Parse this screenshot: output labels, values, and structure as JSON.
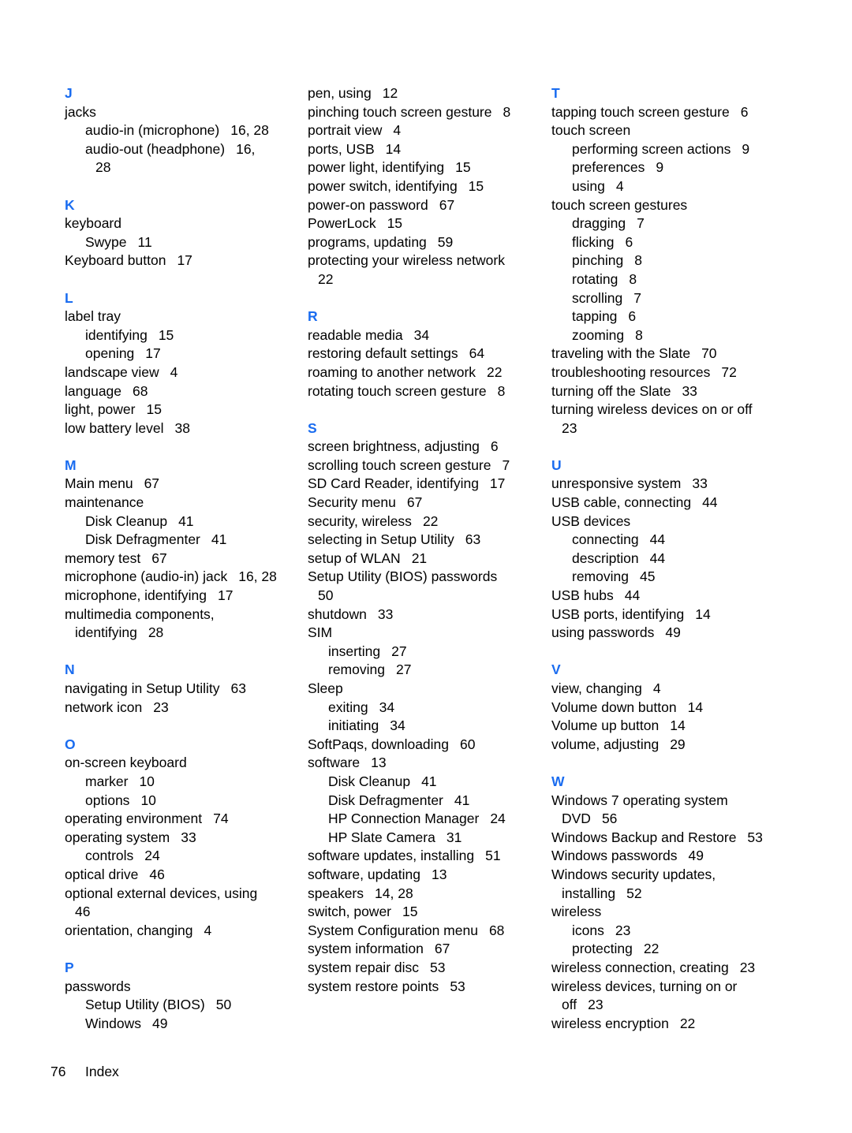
{
  "accent_color": "#1a6cf0",
  "columns": [
    [
      {
        "t": "h",
        "text": "J"
      },
      {
        "t": "e",
        "lvl": 1,
        "text": "jacks",
        "pages": ""
      },
      {
        "t": "e",
        "lvl": 2,
        "text": "audio-in (microphone)",
        "pages": "16, 28"
      },
      {
        "t": "e",
        "lvl": 2,
        "text": "audio-out (headphone)",
        "pages": "16,"
      },
      {
        "t": "c",
        "lvl": 2,
        "text": "",
        "pages": "28"
      },
      {
        "t": "g"
      },
      {
        "t": "h",
        "text": "K"
      },
      {
        "t": "e",
        "lvl": 1,
        "text": "keyboard",
        "pages": ""
      },
      {
        "t": "e",
        "lvl": 2,
        "text": "Swype",
        "pages": "11"
      },
      {
        "t": "e",
        "lvl": 1,
        "text": "Keyboard button",
        "pages": "17"
      },
      {
        "t": "g"
      },
      {
        "t": "h",
        "text": "L"
      },
      {
        "t": "e",
        "lvl": 1,
        "text": "label tray",
        "pages": ""
      },
      {
        "t": "e",
        "lvl": 2,
        "text": "identifying",
        "pages": "15"
      },
      {
        "t": "e",
        "lvl": 2,
        "text": "opening",
        "pages": "17"
      },
      {
        "t": "e",
        "lvl": 1,
        "text": "landscape view",
        "pages": "4"
      },
      {
        "t": "e",
        "lvl": 1,
        "text": "language",
        "pages": "68"
      },
      {
        "t": "e",
        "lvl": 1,
        "text": "light, power",
        "pages": "15"
      },
      {
        "t": "e",
        "lvl": 1,
        "text": "low battery level",
        "pages": "38"
      },
      {
        "t": "g"
      },
      {
        "t": "h",
        "text": "M"
      },
      {
        "t": "e",
        "lvl": 1,
        "text": "Main menu",
        "pages": "67"
      },
      {
        "t": "e",
        "lvl": 1,
        "text": "maintenance",
        "pages": ""
      },
      {
        "t": "e",
        "lvl": 2,
        "text": "Disk Cleanup",
        "pages": "41"
      },
      {
        "t": "e",
        "lvl": 2,
        "text": "Disk Defragmenter",
        "pages": "41"
      },
      {
        "t": "e",
        "lvl": 1,
        "text": "memory test",
        "pages": "67"
      },
      {
        "t": "e",
        "lvl": 1,
        "text": "microphone (audio-in) jack",
        "pages": "16, 28"
      },
      {
        "t": "e",
        "lvl": 1,
        "text": "microphone, identifying",
        "pages": "17"
      },
      {
        "t": "e",
        "lvl": 1,
        "text": "multimedia components,",
        "pages": ""
      },
      {
        "t": "c",
        "lvl": 1,
        "text": "identifying",
        "pages": "28"
      },
      {
        "t": "g"
      },
      {
        "t": "h",
        "text": "N"
      },
      {
        "t": "e",
        "lvl": 1,
        "text": "navigating in Setup Utility",
        "pages": "63"
      },
      {
        "t": "e",
        "lvl": 1,
        "text": "network icon",
        "pages": "23"
      },
      {
        "t": "g"
      },
      {
        "t": "h",
        "text": "O"
      },
      {
        "t": "e",
        "lvl": 1,
        "text": "on-screen keyboard",
        "pages": ""
      },
      {
        "t": "e",
        "lvl": 2,
        "text": "marker",
        "pages": "10"
      },
      {
        "t": "e",
        "lvl": 2,
        "text": "options",
        "pages": "10"
      },
      {
        "t": "e",
        "lvl": 1,
        "text": "operating environment",
        "pages": "74"
      },
      {
        "t": "e",
        "lvl": 1,
        "text": "operating system",
        "pages": "33"
      },
      {
        "t": "e",
        "lvl": 2,
        "text": "controls",
        "pages": "24"
      },
      {
        "t": "e",
        "lvl": 1,
        "text": "optical drive",
        "pages": "46"
      },
      {
        "t": "e",
        "lvl": 1,
        "text": "optional external devices, using",
        "pages": ""
      },
      {
        "t": "c",
        "lvl": 1,
        "text": "",
        "pages": "46"
      },
      {
        "t": "e",
        "lvl": 1,
        "text": "orientation, changing",
        "pages": "4"
      },
      {
        "t": "g"
      },
      {
        "t": "h",
        "text": "P"
      },
      {
        "t": "e",
        "lvl": 1,
        "text": "passwords",
        "pages": ""
      },
      {
        "t": "e",
        "lvl": 2,
        "text": "Setup Utility (BIOS)",
        "pages": "50"
      },
      {
        "t": "e",
        "lvl": 2,
        "text": "Windows",
        "pages": "49"
      }
    ],
    [
      {
        "t": "e",
        "lvl": 1,
        "text": "pen, using",
        "pages": "12"
      },
      {
        "t": "e",
        "lvl": 1,
        "text": "pinching touch screen gesture",
        "pages": "8"
      },
      {
        "t": "e",
        "lvl": 1,
        "text": "portrait view",
        "pages": "4"
      },
      {
        "t": "e",
        "lvl": 1,
        "text": "ports, USB",
        "pages": "14"
      },
      {
        "t": "e",
        "lvl": 1,
        "text": "power light, identifying",
        "pages": "15"
      },
      {
        "t": "e",
        "lvl": 1,
        "text": "power switch, identifying",
        "pages": "15"
      },
      {
        "t": "e",
        "lvl": 1,
        "text": "power-on password",
        "pages": "67"
      },
      {
        "t": "e",
        "lvl": 1,
        "text": "PowerLock",
        "pages": "15"
      },
      {
        "t": "e",
        "lvl": 1,
        "text": "programs, updating",
        "pages": "59"
      },
      {
        "t": "e",
        "lvl": 1,
        "text": "protecting your wireless network",
        "pages": ""
      },
      {
        "t": "c",
        "lvl": 1,
        "text": "",
        "pages": "22"
      },
      {
        "t": "g"
      },
      {
        "t": "h",
        "text": "R"
      },
      {
        "t": "e",
        "lvl": 1,
        "text": "readable media",
        "pages": "34"
      },
      {
        "t": "e",
        "lvl": 1,
        "text": "restoring default settings",
        "pages": "64"
      },
      {
        "t": "e",
        "lvl": 1,
        "text": "roaming to another network",
        "pages": "22"
      },
      {
        "t": "e",
        "lvl": 1,
        "text": "rotating touch screen gesture",
        "pages": "8"
      },
      {
        "t": "g"
      },
      {
        "t": "h",
        "text": "S"
      },
      {
        "t": "e",
        "lvl": 1,
        "text": "screen brightness, adjusting",
        "pages": "6"
      },
      {
        "t": "e",
        "lvl": 1,
        "text": "scrolling touch screen gesture",
        "pages": "7"
      },
      {
        "t": "e",
        "lvl": 1,
        "text": "SD Card Reader, identifying",
        "pages": "17"
      },
      {
        "t": "e",
        "lvl": 1,
        "text": "Security menu",
        "pages": "67"
      },
      {
        "t": "e",
        "lvl": 1,
        "text": "security, wireless",
        "pages": "22"
      },
      {
        "t": "e",
        "lvl": 1,
        "text": "selecting in Setup Utility",
        "pages": "63"
      },
      {
        "t": "e",
        "lvl": 1,
        "text": "setup of WLAN",
        "pages": "21"
      },
      {
        "t": "e",
        "lvl": 1,
        "text": "Setup Utility (BIOS) passwords",
        "pages": ""
      },
      {
        "t": "c",
        "lvl": 1,
        "text": "",
        "pages": "50"
      },
      {
        "t": "e",
        "lvl": 1,
        "text": "shutdown",
        "pages": "33"
      },
      {
        "t": "e",
        "lvl": 1,
        "text": "SIM",
        "pages": ""
      },
      {
        "t": "e",
        "lvl": 2,
        "text": "inserting",
        "pages": "27"
      },
      {
        "t": "e",
        "lvl": 2,
        "text": "removing",
        "pages": "27"
      },
      {
        "t": "e",
        "lvl": 1,
        "text": "Sleep",
        "pages": ""
      },
      {
        "t": "e",
        "lvl": 2,
        "text": "exiting",
        "pages": "34"
      },
      {
        "t": "e",
        "lvl": 2,
        "text": "initiating",
        "pages": "34"
      },
      {
        "t": "e",
        "lvl": 1,
        "text": "SoftPaqs, downloading",
        "pages": "60"
      },
      {
        "t": "e",
        "lvl": 1,
        "text": "software",
        "pages": "13"
      },
      {
        "t": "e",
        "lvl": 2,
        "text": "Disk Cleanup",
        "pages": "41"
      },
      {
        "t": "e",
        "lvl": 2,
        "text": "Disk Defragmenter",
        "pages": "41"
      },
      {
        "t": "e",
        "lvl": 2,
        "text": "HP Connection Manager",
        "pages": "24"
      },
      {
        "t": "e",
        "lvl": 2,
        "text": "HP Slate Camera",
        "pages": "31"
      },
      {
        "t": "e",
        "lvl": 1,
        "text": "software updates, installing",
        "pages": "51"
      },
      {
        "t": "e",
        "lvl": 1,
        "text": "software, updating",
        "pages": "13"
      },
      {
        "t": "e",
        "lvl": 1,
        "text": "speakers",
        "pages": "14, 28"
      },
      {
        "t": "e",
        "lvl": 1,
        "text": "switch, power",
        "pages": "15"
      },
      {
        "t": "e",
        "lvl": 1,
        "text": "System Configuration menu",
        "pages": "68"
      },
      {
        "t": "e",
        "lvl": 1,
        "text": "system information",
        "pages": "67"
      },
      {
        "t": "e",
        "lvl": 1,
        "text": "system repair disc",
        "pages": "53"
      },
      {
        "t": "e",
        "lvl": 1,
        "text": "system restore points",
        "pages": "53"
      }
    ],
    [
      {
        "t": "h",
        "text": "T"
      },
      {
        "t": "e",
        "lvl": 1,
        "text": "tapping touch screen gesture",
        "pages": "6"
      },
      {
        "t": "e",
        "lvl": 1,
        "text": "touch screen",
        "pages": ""
      },
      {
        "t": "e",
        "lvl": 2,
        "text": "performing screen actions",
        "pages": "9"
      },
      {
        "t": "e",
        "lvl": 2,
        "text": "preferences",
        "pages": "9"
      },
      {
        "t": "e",
        "lvl": 2,
        "text": "using",
        "pages": "4"
      },
      {
        "t": "e",
        "lvl": 1,
        "text": "touch screen gestures",
        "pages": ""
      },
      {
        "t": "e",
        "lvl": 2,
        "text": "dragging",
        "pages": "7"
      },
      {
        "t": "e",
        "lvl": 2,
        "text": "flicking",
        "pages": "6"
      },
      {
        "t": "e",
        "lvl": 2,
        "text": "pinching",
        "pages": "8"
      },
      {
        "t": "e",
        "lvl": 2,
        "text": "rotating",
        "pages": "8"
      },
      {
        "t": "e",
        "lvl": 2,
        "text": "scrolling",
        "pages": "7"
      },
      {
        "t": "e",
        "lvl": 2,
        "text": "tapping",
        "pages": "6"
      },
      {
        "t": "e",
        "lvl": 2,
        "text": "zooming",
        "pages": "8"
      },
      {
        "t": "e",
        "lvl": 1,
        "text": "traveling with the Slate",
        "pages": "70"
      },
      {
        "t": "e",
        "lvl": 1,
        "text": "troubleshooting resources",
        "pages": "72"
      },
      {
        "t": "e",
        "lvl": 1,
        "text": "turning off the Slate",
        "pages": "33"
      },
      {
        "t": "e",
        "lvl": 1,
        "text": "turning wireless devices on or off",
        "pages": ""
      },
      {
        "t": "c",
        "lvl": 1,
        "text": "",
        "pages": "23"
      },
      {
        "t": "g"
      },
      {
        "t": "h",
        "text": "U"
      },
      {
        "t": "e",
        "lvl": 1,
        "text": "unresponsive system",
        "pages": "33"
      },
      {
        "t": "e",
        "lvl": 1,
        "text": "USB cable, connecting",
        "pages": "44"
      },
      {
        "t": "e",
        "lvl": 1,
        "text": "USB devices",
        "pages": ""
      },
      {
        "t": "e",
        "lvl": 2,
        "text": "connecting",
        "pages": "44"
      },
      {
        "t": "e",
        "lvl": 2,
        "text": "description",
        "pages": "44"
      },
      {
        "t": "e",
        "lvl": 2,
        "text": "removing",
        "pages": "45"
      },
      {
        "t": "e",
        "lvl": 1,
        "text": "USB hubs",
        "pages": "44"
      },
      {
        "t": "e",
        "lvl": 1,
        "text": "USB ports, identifying",
        "pages": "14"
      },
      {
        "t": "e",
        "lvl": 1,
        "text": "using passwords",
        "pages": "49"
      },
      {
        "t": "g"
      },
      {
        "t": "h",
        "text": "V"
      },
      {
        "t": "e",
        "lvl": 1,
        "text": "view, changing",
        "pages": "4"
      },
      {
        "t": "e",
        "lvl": 1,
        "text": "Volume down button",
        "pages": "14"
      },
      {
        "t": "e",
        "lvl": 1,
        "text": "Volume up button",
        "pages": "14"
      },
      {
        "t": "e",
        "lvl": 1,
        "text": "volume, adjusting",
        "pages": "29"
      },
      {
        "t": "g"
      },
      {
        "t": "h",
        "text": "W"
      },
      {
        "t": "e",
        "lvl": 1,
        "text": "Windows 7 operating system",
        "pages": ""
      },
      {
        "t": "c",
        "lvl": 1,
        "text": "DVD",
        "pages": "56"
      },
      {
        "t": "e",
        "lvl": 1,
        "text": "Windows Backup and Restore",
        "pages": "53"
      },
      {
        "t": "e",
        "lvl": 1,
        "text": "Windows passwords",
        "pages": "49"
      },
      {
        "t": "e",
        "lvl": 1,
        "text": "Windows security updates,",
        "pages": ""
      },
      {
        "t": "c",
        "lvl": 1,
        "text": "installing",
        "pages": "52"
      },
      {
        "t": "e",
        "lvl": 1,
        "text": "wireless",
        "pages": ""
      },
      {
        "t": "e",
        "lvl": 2,
        "text": "icons",
        "pages": "23"
      },
      {
        "t": "e",
        "lvl": 2,
        "text": "protecting",
        "pages": "22"
      },
      {
        "t": "e",
        "lvl": 1,
        "text": "wireless connection, creating",
        "pages": "23"
      },
      {
        "t": "e",
        "lvl": 1,
        "text": "wireless devices, turning on or",
        "pages": ""
      },
      {
        "t": "c",
        "lvl": 1,
        "text": "off",
        "pages": "23"
      },
      {
        "t": "e",
        "lvl": 1,
        "text": "wireless encryption",
        "pages": "22"
      }
    ]
  ],
  "footer": {
    "page_number": "76",
    "section": "Index"
  }
}
